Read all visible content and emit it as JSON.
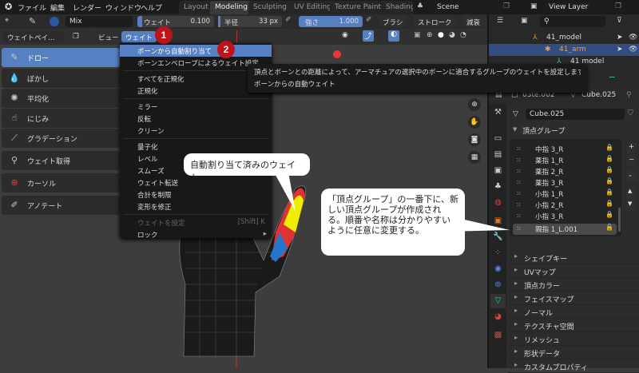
{
  "menubar": {
    "items": [
      "ファイル",
      "編集",
      "レンダー",
      "ウィンドウ",
      "ヘルプ"
    ]
  },
  "workspaces": [
    "Layout",
    "Modeling",
    "Sculpting",
    "UV Editing",
    "Texture Paint",
    "Shading"
  ],
  "scene": "Scene",
  "view_layer": "View Layer",
  "tool_settings": {
    "vertex_color": "Mix",
    "weight_label": "ウェイト",
    "weight_value": "0.100",
    "radius_label": "半径",
    "radius_value": "33 px",
    "strength_label": "強さ",
    "strength_value": "1.000",
    "brush": "ブラシ",
    "stroke": "ストローク",
    "falloff": "減衰"
  },
  "header": {
    "mode": "ウェイトペイ…",
    "view": "ビュー",
    "weight": "ウェイト"
  },
  "tools": [
    "ドロー",
    "ぼかし",
    "平均化",
    "にじみ",
    "グラデーション",
    "ウェイト取得",
    "カーソル",
    "アノテート"
  ],
  "weight_menu": {
    "items": [
      "ボーンから自動割り当て",
      "ボーンエンベロープによるウェイト設定",
      "すべてを正規化",
      "正規化",
      "ミラー",
      "反転",
      "クリーン",
      "量子化",
      "レベル",
      "スムーズ",
      "ウェイト転送",
      "合計を制限",
      "変形を修正",
      "ウェイトを設定",
      "ロック"
    ],
    "set_weight_shortcut": "[Shift] K"
  },
  "tooltip": {
    "line1": "頂点とボーンとの距離によって、アーマチュアの選択中のボーンに適合するグループのウェイトを設定します: 自動",
    "line2": "ボーンからの自動ウェイト"
  },
  "outliner": {
    "rows": [
      "41_model",
      "41_arm",
      "41 model"
    ]
  },
  "properties": {
    "context_left": "03te.002",
    "context_right": "Cube.025",
    "mesh_name": "Cube.025",
    "vertex_groups_title": "頂点グループ",
    "vertex_groups": [
      "中指 3_R",
      "薬指 1_R",
      "薬指 2_R",
      "薬指 3_R",
      "小指 1_R",
      "小指 2_R",
      "小指 3_R",
      "親指 1_L.001"
    ],
    "panels": [
      "シェイプキー",
      "UVマップ",
      "頂点カラー",
      "フェイスマップ",
      "ノーマル",
      "テクスチャ空間",
      "リメッシュ",
      "形状データ",
      "カスタムプロパティ"
    ]
  },
  "annotations": {
    "badge1": "1",
    "badge2": "2",
    "callout1": "自動割り当て済みのウェイト",
    "callout2": "「頂点グループ」の一番下に、新しい頂点グループが作成される。順番や名称は分かりやすいように任意に変更する。"
  },
  "colors": {
    "accent": "#5680c2",
    "badge": "#c0121a"
  }
}
